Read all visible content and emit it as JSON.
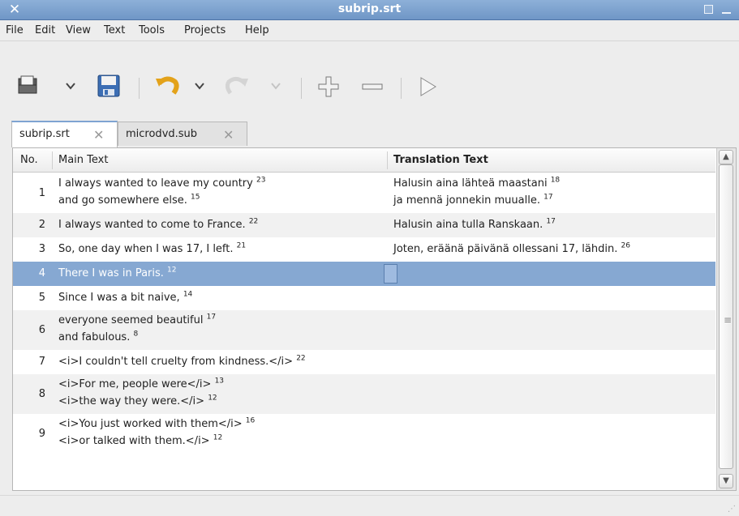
{
  "window": {
    "title": "subrip.srt"
  },
  "menu": [
    "File",
    "Edit",
    "View",
    "Text",
    "Tools",
    "Projects",
    "Help"
  ],
  "tabs": [
    {
      "label": "subrip.srt",
      "active": true
    },
    {
      "label": "microdvd.sub",
      "active": false
    }
  ],
  "columns": {
    "no": "No.",
    "main": "Main Text",
    "translation": "Translation Text"
  },
  "rows": [
    {
      "no": "1",
      "main": [
        [
          "I always wanted to leave my country",
          "23"
        ],
        [
          "and go somewhere else.",
          "15"
        ]
      ],
      "translation": [
        [
          "Halusin aina lähteä maastani",
          "18"
        ],
        [
          "ja mennä jonnekin muualle.",
          "17"
        ]
      ]
    },
    {
      "no": "2",
      "main": [
        [
          "I always wanted to come to France.",
          "22"
        ]
      ],
      "translation": [
        [
          "Halusin aina tulla Ranskaan.",
          "17"
        ]
      ]
    },
    {
      "no": "3",
      "main": [
        [
          "So, one day when I was 17, I left.",
          "21"
        ]
      ],
      "translation": [
        [
          "Joten, eräänä päivänä ollessani 17, lähdin.",
          "26"
        ]
      ]
    },
    {
      "no": "4",
      "main": [
        [
          "There I was in Paris.",
          "12"
        ]
      ],
      "translation": [],
      "selected": true
    },
    {
      "no": "5",
      "main": [
        [
          "Since I was a bit naive,",
          "14"
        ]
      ],
      "translation": []
    },
    {
      "no": "6",
      "main": [
        [
          "everyone seemed beautiful",
          "17"
        ],
        [
          "and fabulous.",
          "8"
        ]
      ],
      "translation": []
    },
    {
      "no": "7",
      "main": [
        [
          "<i>I couldn't tell cruelty from kindness.</i>",
          "22"
        ]
      ],
      "translation": []
    },
    {
      "no": "8",
      "main": [
        [
          "<i>For me, people were</i>",
          "13"
        ],
        [
          "<i>the way they were.</i>",
          "12"
        ]
      ],
      "translation": []
    },
    {
      "no": "9",
      "main": [
        [
          "<i>You just worked with them</i>",
          "16"
        ],
        [
          "<i>or talked with them.</i>",
          "12"
        ]
      ],
      "translation": []
    }
  ],
  "colors": {
    "selection": "#86a8d2",
    "titlebar": "#7ea3cf"
  }
}
